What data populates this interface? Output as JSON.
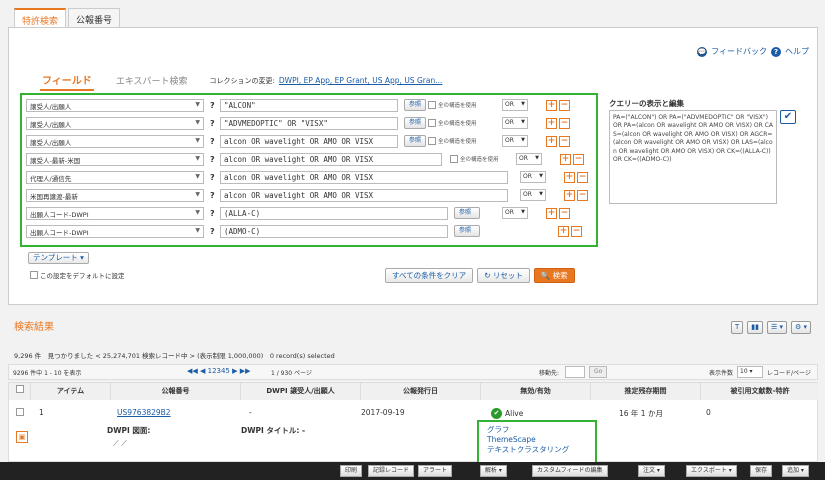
{
  "tabs": [
    "特許検索",
    "公報番号"
  ],
  "links": {
    "feedback": "フィードバック",
    "help": "ヘルプ"
  },
  "subtabs": {
    "field": "フィールド",
    "expert": "エキスパート検索",
    "collection_label": "コレクションの変更:",
    "collection_link": "DWPI, EP App, EP Grant, US App, US Gran..."
  },
  "rows": [
    {
      "field": "譲受人/出願人",
      "value": "\"ALCON\"",
      "ref": "参照",
      "check": "全の構造を使用",
      "op": "OR"
    },
    {
      "field": "譲受人/出願人",
      "value": "\"ADVMEDOPTIC\" OR \"VISX\"",
      "ref": "参照",
      "check": "全の構造を使用",
      "op": "OR"
    },
    {
      "field": "譲受人/出願人",
      "value": "alcon OR wavelight OR AMO OR VISX",
      "ref": "参照",
      "check": "全の構造を使用",
      "op": "OR"
    },
    {
      "field": "譲受人-最新-米国",
      "value": "alcon OR wavelight OR AMO OR VISX",
      "ref": "",
      "check": "全の構造を使用",
      "op": "OR"
    },
    {
      "field": "代理人/通信先",
      "value": "alcon OR wavelight OR AMO OR VISX",
      "ref": "",
      "check": "",
      "op": "OR"
    },
    {
      "field": "米国再譲渡-最新",
      "value": "alcon OR wavelight OR AMO OR VISX",
      "ref": "",
      "check": "",
      "op": "OR"
    },
    {
      "field": "出願人コード-DWPI",
      "value": "(ALLA-C)",
      "ref": "参照",
      "check": "",
      "op": "OR"
    },
    {
      "field": "出願人コード-DWPI",
      "value": "(ADMO-C)",
      "ref": "参照",
      "check": "",
      "op": ""
    }
  ],
  "query": {
    "title": "クエリーの表示と編集",
    "text": "PA=(\"ALCON\") OR PA=(\"ADVMEDOPTIC\" OR \"VISX\") OR PA=(alcon OR wavelight OR AMO OR VISX) OR CAS=(alcon OR wavelight OR AMO OR VISX) OR AGCR=(alcon OR wavelight OR AMO OR VISX) OR LAS=(alcon OR wavelight OR AMO OR VISX) OR CK=((ALLA-C)) OR CK=((ADMO-C))"
  },
  "template": "テンプレート",
  "default_label": "この設定をデフォルトに設定",
  "actions": {
    "clear": "すべての条件をクリア",
    "reset": "リセット",
    "search": "検索"
  },
  "results": {
    "title": "検索結果",
    "count": "9,296 件　見つかりました < 25,274,701 検索レコード中 > (表示制限 1,000,000)　0 record(s) selected",
    "range": "9296 件中 1 - 10 を表示",
    "pages": "12345",
    "page_of": "1 / 930 ページ",
    "move_label": "移動先:",
    "go": "Go",
    "per_page_label": "表示件数",
    "per_page": "10",
    "per_page_unit": "レコード/ページ",
    "headers": [
      "アイテム",
      "公報番号",
      "DWPI 譲受人/出願人",
      "公報発行日",
      "無効/有効",
      "推定残存期間",
      "被引用文献数-特許"
    ],
    "row": {
      "num": "1",
      "pub": "US9763829B2",
      "assignee": "-",
      "date": "2017-09-19",
      "status": "Alive",
      "term": "16 年 1 か月",
      "cites": "0",
      "drawing_label": "DWPI 図面:",
      "title_label": "DWPI タイトル: -"
    }
  },
  "popup": [
    "グラフ",
    "ThemeScape",
    "テキストクラスタリング"
  ],
  "footer": [
    "印刷",
    "記録レコード",
    "アラート",
    "解析",
    "カスタムフィードの編集",
    "注文",
    "エクスポート",
    "保存",
    "追加"
  ]
}
